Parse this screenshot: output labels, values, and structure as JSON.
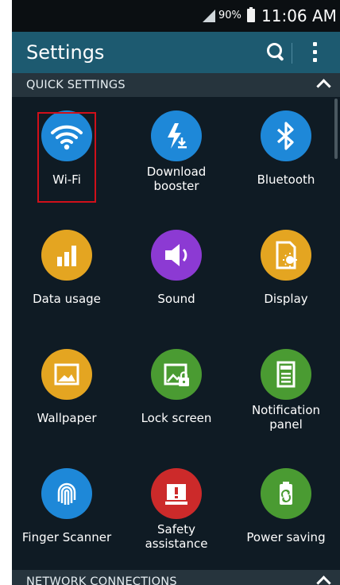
{
  "status_bar": {
    "battery": "90%",
    "time": "11:06 AM"
  },
  "app_bar": {
    "title": "Settings"
  },
  "sections": {
    "quick": {
      "label": "QUICK SETTINGS"
    },
    "network": {
      "label": "NETWORK CONNECTIONS"
    }
  },
  "tiles": [
    {
      "lines": [
        "Wi-Fi"
      ],
      "color": "#1e88d8",
      "icon": "wifi-icon"
    },
    {
      "lines": [
        "Download",
        "booster"
      ],
      "color": "#1e88d8",
      "icon": "download-booster-icon"
    },
    {
      "lines": [
        "Bluetooth"
      ],
      "color": "#1e88d8",
      "icon": "bluetooth-icon"
    },
    {
      "lines": [
        "Data usage"
      ],
      "color": "#e4a521",
      "icon": "data-usage-icon"
    },
    {
      "lines": [
        "Sound"
      ],
      "color": "#8c3ad3",
      "icon": "sound-icon"
    },
    {
      "lines": [
        "Display"
      ],
      "color": "#e4a521",
      "icon": "display-icon"
    },
    {
      "lines": [
        "Wallpaper"
      ],
      "color": "#e4a521",
      "icon": "wallpaper-icon"
    },
    {
      "lines": [
        "Lock screen"
      ],
      "color": "#4a9b32",
      "icon": "lock-screen-icon"
    },
    {
      "lines": [
        "Notification",
        "panel"
      ],
      "color": "#4a9b32",
      "icon": "notification-panel-icon"
    },
    {
      "lines": [
        "Finger Scanner"
      ],
      "color": "#1e88d8",
      "icon": "fingerprint-icon"
    },
    {
      "lines": [
        "Safety",
        "assistance"
      ],
      "color": "#cc2a2a",
      "icon": "safety-icon"
    },
    {
      "lines": [
        "Power saving"
      ],
      "color": "#4a9b32",
      "icon": "power-saving-icon"
    }
  ]
}
